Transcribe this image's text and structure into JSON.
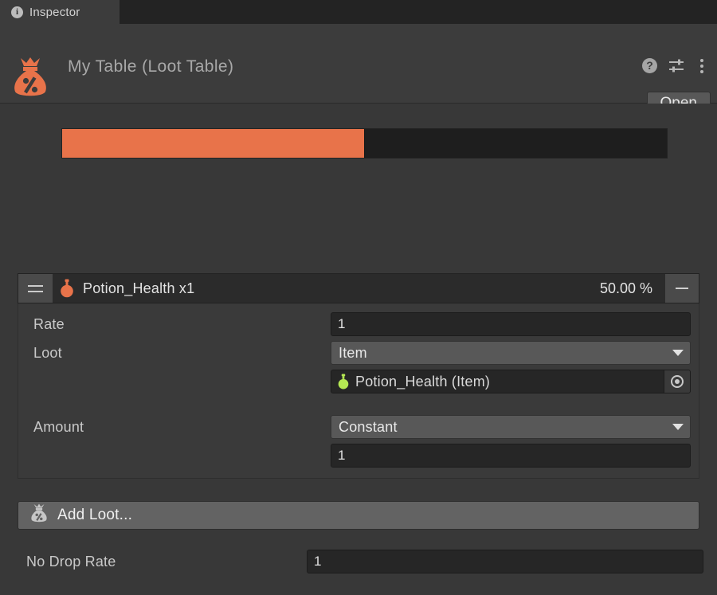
{
  "window": {
    "tab_label": "Inspector",
    "tab_icon": "info-icon"
  },
  "header": {
    "title": "My Table (Loot Table)",
    "asset_icon": "loot-bag-percent-icon",
    "help_icon": "help-icon",
    "preset_icon": "preset-sliders-icon",
    "menu_icon": "kebab-menu-icon",
    "open_label": "Open"
  },
  "distribution": {
    "segments": [
      {
        "label": "Potion_Health x1",
        "percent": 50.0,
        "color": "#e8734a"
      }
    ],
    "track_color": "#1e1e1e"
  },
  "entries": [
    {
      "drag_handle_icon": "drag-handle-icon",
      "icon": "potion-orange-icon",
      "title": "Potion_Health x1",
      "percent_label": "50.00 %",
      "remove_label": "−",
      "fields": {
        "rate_label": "Rate",
        "rate_value": "1",
        "loot_label": "Loot",
        "loot_type_value": "Item",
        "loot_object_icon": "potion-green-icon",
        "loot_object_value": "Potion_Health (Item)",
        "loot_object_picker_icon": "target-picker-icon",
        "amount_label": "Amount",
        "amount_mode_value": "Constant",
        "amount_value": "1"
      }
    }
  ],
  "add_loot": {
    "label": "Add Loot...",
    "icon": "loot-bag-percent-icon"
  },
  "no_drop": {
    "label": "No Drop Rate",
    "value": "1"
  },
  "colors": {
    "accent": "#e8734a",
    "panel": "#383838",
    "header": "#3c3c3c",
    "field": "#262626",
    "dropdown": "#585858"
  }
}
